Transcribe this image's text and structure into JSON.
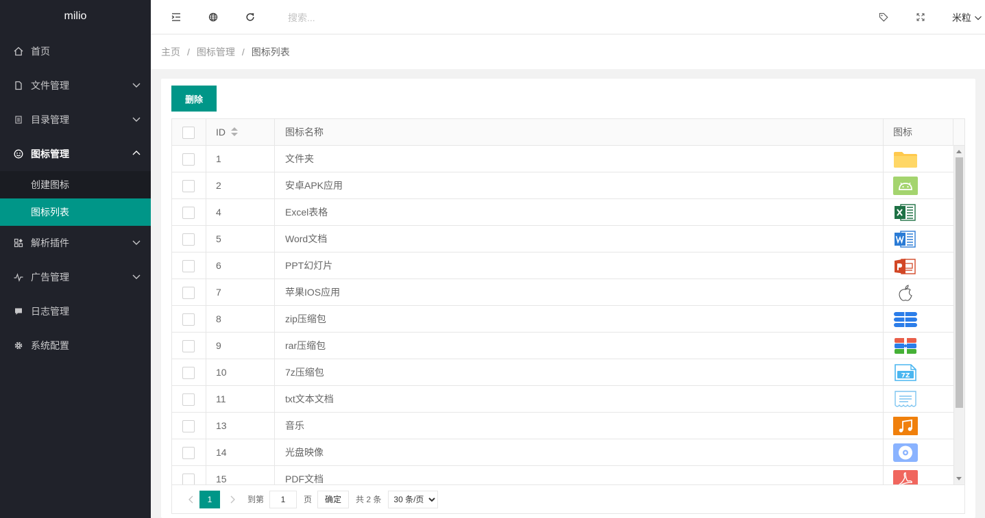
{
  "app": {
    "logo": "milio"
  },
  "sidebar": {
    "items": [
      {
        "label": "首页",
        "icon": "home-icon"
      },
      {
        "label": "文件管理",
        "icon": "file-icon"
      },
      {
        "label": "目录管理",
        "icon": "directory-icon"
      },
      {
        "label": "图标管理",
        "icon": "smile-icon",
        "sub": [
          {
            "label": "创建图标"
          },
          {
            "label": "图标列表"
          }
        ]
      },
      {
        "label": "解析插件",
        "icon": "apps-icon"
      },
      {
        "label": "广告管理",
        "icon": "pulse-icon"
      },
      {
        "label": "日志管理",
        "icon": "chat-icon"
      },
      {
        "label": "系统配置",
        "icon": "gear-icon"
      }
    ]
  },
  "header": {
    "search_placeholder": "搜索...",
    "user": "米粒"
  },
  "breadcrumb": [
    "主页",
    "图标管理",
    "图标列表"
  ],
  "toolbar": {
    "delete_label": "删除"
  },
  "table": {
    "columns": [
      "ID",
      "图标名称",
      "图标"
    ],
    "rows": [
      {
        "id": "1",
        "name": "文件夹",
        "icon": "folder-icon"
      },
      {
        "id": "2",
        "name": "安卓APK应用",
        "icon": "android-icon"
      },
      {
        "id": "4",
        "name": "Excel表格",
        "icon": "excel-icon"
      },
      {
        "id": "5",
        "name": "Word文档",
        "icon": "word-icon"
      },
      {
        "id": "6",
        "name": "PPT幻灯片",
        "icon": "ppt-icon"
      },
      {
        "id": "7",
        "name": "苹果IOS应用",
        "icon": "apple-icon"
      },
      {
        "id": "8",
        "name": "zip压缩包",
        "icon": "zip-icon"
      },
      {
        "id": "9",
        "name": "rar压缩包",
        "icon": "rar-icon"
      },
      {
        "id": "10",
        "name": "7z压缩包",
        "icon": "7z-icon",
        "icon_text": "7Z"
      },
      {
        "id": "11",
        "name": "txt文本文档",
        "icon": "txt-icon"
      },
      {
        "id": "13",
        "name": "音乐",
        "icon": "music-icon"
      },
      {
        "id": "14",
        "name": "光盘映像",
        "icon": "disc-icon"
      },
      {
        "id": "15",
        "name": "PDF文档",
        "icon": "pdf-icon"
      }
    ]
  },
  "pager": {
    "current": "1",
    "goto_label": "到第",
    "goto_value": "1",
    "page_label": "页",
    "confirm": "确定",
    "total": "共 2 条",
    "per_page": "30 条/页"
  },
  "colors": {
    "accent": "#009688",
    "sidebar_bg": "#20222a"
  }
}
